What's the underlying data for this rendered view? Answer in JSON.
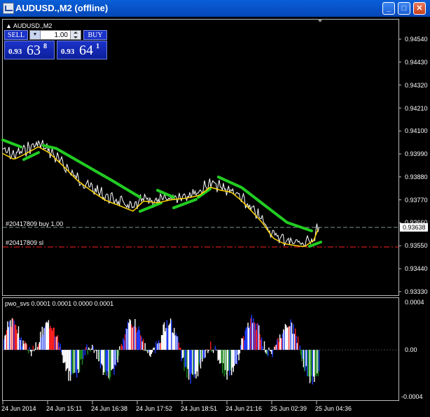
{
  "window": {
    "title": "AUDUSD.,M2 (offline)",
    "buttons": {
      "minimize": "_",
      "maximize": "□",
      "close": "✕"
    }
  },
  "chart": {
    "symbol_label": "AUDUSD.,M2",
    "price_axis": [
      "0.94540",
      "0.94430",
      "0.94320",
      "0.94210",
      "0.94100",
      "0.93990",
      "0.93880",
      "0.93770",
      "0.93660",
      "0.93550",
      "0.93440",
      "0.93330"
    ],
    "current_price": "0.93638",
    "trade_buy_label": "#20417809 buy 1.00",
    "trade_sl_label": "#20417809 sl",
    "colors": {
      "price": "#ffffff",
      "fast_ma": "#ffd700",
      "slow_ma": "#22cc22",
      "trade_line": "#7a9a8a",
      "sl_line": "#ff2020"
    }
  },
  "trade_panel": {
    "sell_label": "SELL",
    "buy_label": "BUY",
    "lot_value": "1.00",
    "sell_quote": {
      "small": "0.93",
      "big": "63",
      "sup": "8"
    },
    "buy_quote": {
      "small": "0.93",
      "big": "64",
      "sup": "1"
    }
  },
  "indicator": {
    "label": "pwo_svs 0.0001 0.0001 0.0000 0.0001",
    "axis": [
      "0.0004",
      "0.00",
      "-0.0004"
    ]
  },
  "time_axis": [
    "24 Jun 2014",
    "24 Jun 15:11",
    "24 Jun 16:38",
    "24 Jun 17:52",
    "24 Jun 18:51",
    "24 Jun 21:16",
    "25 Jun 02:39",
    "25 Jun 04:36"
  ]
}
